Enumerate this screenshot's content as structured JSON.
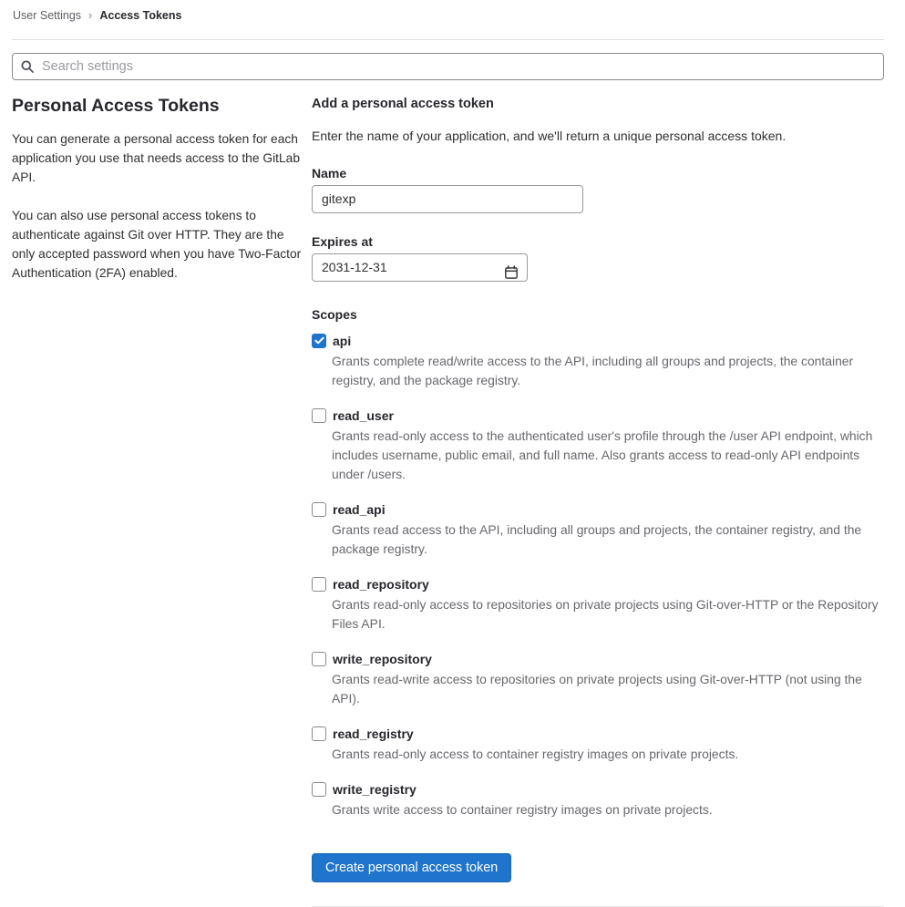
{
  "breadcrumb": {
    "separator": "›",
    "parent": "User Settings",
    "current": "Access Tokens"
  },
  "search": {
    "placeholder": "Search settings"
  },
  "sidebar": {
    "title": "Personal Access Tokens",
    "paragraphs": [
      "You can generate a personal access token for each application you use that needs access to the GitLab API.",
      "You can also use personal access tokens to authenticate against Git over HTTP. They are the only accepted password when you have Two-Factor Authentication (2FA) enabled."
    ]
  },
  "form": {
    "title": "Add a personal access token",
    "description": "Enter the name of your application, and we'll return a unique personal access token.",
    "name_field": {
      "label": "Name",
      "value": "gitexp"
    },
    "expires_field": {
      "label": "Expires at",
      "value": "2031-12-31"
    },
    "scopes_label": "Scopes",
    "scopes": [
      {
        "name": "api",
        "checked": true,
        "description": "Grants complete read/write access to the API, including all groups and projects, the container registry, and the package registry."
      },
      {
        "name": "read_user",
        "checked": false,
        "description": "Grants read-only access to the authenticated user's profile through the /user API endpoint, which includes username, public email, and full name. Also grants access to read-only API endpoints under /users."
      },
      {
        "name": "read_api",
        "checked": false,
        "description": "Grants read access to the API, including all groups and projects, the container registry, and the package registry."
      },
      {
        "name": "read_repository",
        "checked": false,
        "description": "Grants read-only access to repositories on private projects using Git-over-HTTP or the Repository Files API."
      },
      {
        "name": "write_repository",
        "checked": false,
        "description": "Grants read-write access to repositories on private projects using Git-over-HTTP (not using the API)."
      },
      {
        "name": "read_registry",
        "checked": false,
        "description": "Grants read-only access to container registry images on private projects."
      },
      {
        "name": "write_registry",
        "checked": false,
        "description": "Grants write access to container registry images on private projects."
      }
    ],
    "submit_label": "Create personal access token"
  },
  "colors": {
    "accent_blue": "#1f75cb",
    "text_primary": "#303030",
    "text_secondary": "#68676d",
    "input_border": "#9a999e",
    "divider": "#e1e1e1"
  }
}
